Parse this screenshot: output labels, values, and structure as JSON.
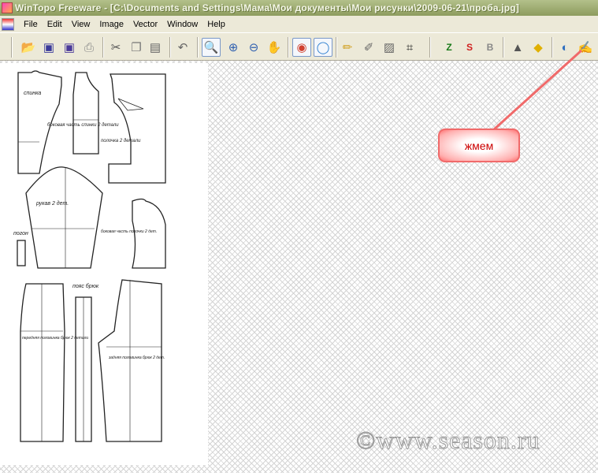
{
  "window": {
    "title": "WinTopo Freeware - [C:\\Documents and Settings\\Мама\\Мои документы\\Мои рисунки\\2009-06-21\\проба.jpg]"
  },
  "menu": [
    "File",
    "Edit",
    "View",
    "Image",
    "Vector",
    "Window",
    "Help"
  ],
  "toolbar": {
    "z_label": "Z",
    "s_label": "S",
    "b_label": "B"
  },
  "callout": {
    "text": "жмем",
    "color": "#f06a6a"
  },
  "watermark": "©www.season.ru",
  "pattern_labels": {
    "back": "спинка",
    "side_back": "боковая часть спинки 2 детали",
    "front": "полочка 2 детали",
    "sleeve": "рукав 2 дет.",
    "side_front": "боковая часть полочки 2 дет.",
    "strap": "погон",
    "front_trousers": "передняя половинка брюк 2 детали",
    "belt": "пояс брюк",
    "back_trousers": "задняя половинка брюк 2 дет."
  }
}
